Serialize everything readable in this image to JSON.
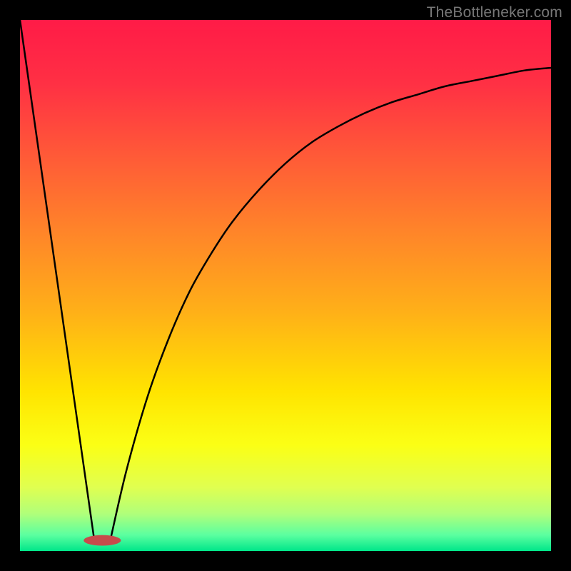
{
  "watermark": "TheBottleneker.com",
  "chart_data": {
    "type": "line",
    "title": "",
    "xlabel": "",
    "ylabel": "",
    "xlim": [
      0,
      100
    ],
    "ylim": [
      0,
      100
    ],
    "grid": false,
    "legend": false,
    "series": [
      {
        "name": "left-line",
        "x": [
          0,
          14
        ],
        "y": [
          100,
          2
        ]
      },
      {
        "name": "right-curve",
        "x": [
          17,
          20,
          24,
          28,
          32,
          36,
          40,
          45,
          50,
          55,
          60,
          65,
          70,
          75,
          80,
          85,
          90,
          95,
          100
        ],
        "y": [
          2,
          15,
          29,
          40,
          49,
          56,
          62,
          68,
          73,
          77,
          80,
          82.5,
          84.5,
          86,
          87.5,
          88.5,
          89.5,
          90.5,
          91
        ]
      }
    ],
    "background_gradient": {
      "stops": [
        {
          "offset": 0.0,
          "color": "#ff1b47"
        },
        {
          "offset": 0.12,
          "color": "#ff3044"
        },
        {
          "offset": 0.25,
          "color": "#ff5838"
        },
        {
          "offset": 0.4,
          "color": "#ff8529"
        },
        {
          "offset": 0.55,
          "color": "#ffb018"
        },
        {
          "offset": 0.7,
          "color": "#ffe400"
        },
        {
          "offset": 0.8,
          "color": "#fbff15"
        },
        {
          "offset": 0.88,
          "color": "#e0ff50"
        },
        {
          "offset": 0.93,
          "color": "#b0ff7a"
        },
        {
          "offset": 0.97,
          "color": "#5bffa0"
        },
        {
          "offset": 1.0,
          "color": "#00e68a"
        }
      ]
    },
    "marker": {
      "cx": 15.5,
      "cy": 2,
      "rx": 3.5,
      "ry": 1.0,
      "color": "#c74b4b"
    }
  }
}
